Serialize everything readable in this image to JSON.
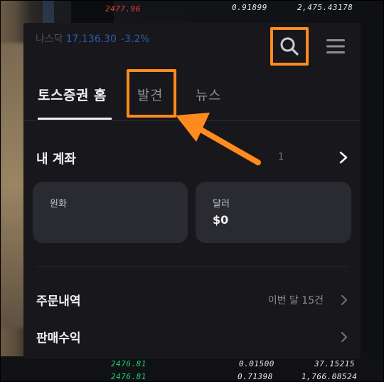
{
  "background_tickers": {
    "top": [
      {
        "text": "2477.96",
        "tone": "red"
      },
      {
        "text": "0.91899",
        "tone": "white"
      },
      {
        "text": "2,475.43178",
        "tone": "white"
      }
    ],
    "bottom": [
      {
        "text": "2476.81",
        "tone": "green"
      },
      {
        "text": "0.01500",
        "tone": "white"
      },
      {
        "text": "37.15215",
        "tone": "white"
      },
      {
        "text": "2476.81",
        "tone": "green"
      },
      {
        "text": "0.71398",
        "tone": "white"
      },
      {
        "text": "1,766.08524",
        "tone": "white"
      }
    ]
  },
  "topbar": {
    "index_name": "나스닥",
    "index_value": "17,136.30",
    "index_change": "-3.2%"
  },
  "tabs": {
    "home": "토스증권 홈",
    "discover": "발견",
    "news": "뉴스"
  },
  "account": {
    "title": "내 계좌",
    "count": "1",
    "cards": {
      "krw_label": "원화",
      "krw_amount": "",
      "usd_label": "달러",
      "usd_amount": "$0"
    }
  },
  "rows": {
    "orders_title": "주문내역",
    "orders_summary": "이번 달 15건",
    "profit_title": "판매수익"
  },
  "colors": {
    "highlight": "#ff8a1e",
    "panel": "#17171c",
    "card": "#2a2b31"
  },
  "icons": [
    "search-icon",
    "hamburger-menu-icon",
    "chevron-right-icon",
    "annotation-arrow"
  ]
}
